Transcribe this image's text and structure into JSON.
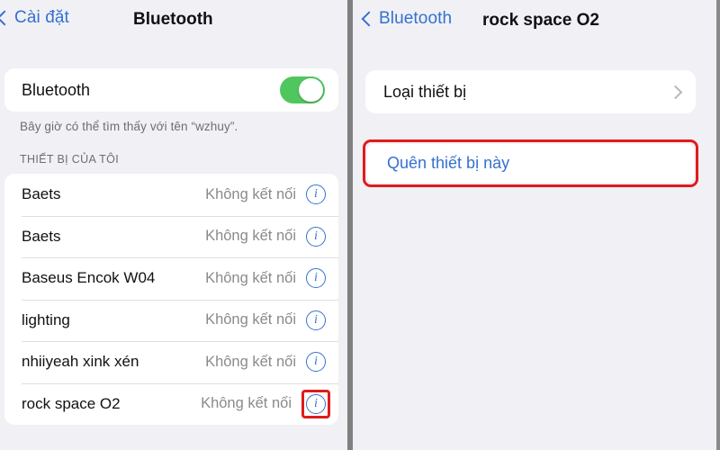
{
  "left_panel": {
    "navbar": {
      "back_label": "Cài đặt",
      "back_icon": "chevron-left-icon",
      "title": "Bluetooth"
    },
    "bluetooth_row": {
      "label": "Bluetooth",
      "toggle_state": "on",
      "toggle_color": "#4FC75E"
    },
    "footnote": "Bây giờ có thể tìm thấy với tên “wzhuy”.",
    "section_header": "THIẾT BỊ CỦA TÔI",
    "devices": [
      {
        "name": "Baets",
        "status": "Không kết nối",
        "info_icon": "info-circle-icon",
        "highlighted": false
      },
      {
        "name": "Baets",
        "status": "Không kết nối",
        "info_icon": "info-circle-icon",
        "highlighted": false
      },
      {
        "name": "Baseus Encok W04",
        "status": "Không kết nối",
        "info_icon": "info-circle-icon",
        "highlighted": false
      },
      {
        "name": "lighting",
        "status": "Không kết nối",
        "info_icon": "info-circle-icon",
        "highlighted": false
      },
      {
        "name": "nhiiyeah xink xén",
        "status": "Không kết nối",
        "info_icon": "info-circle-icon",
        "highlighted": false
      },
      {
        "name": "rock space O2",
        "status": "Không kết nối",
        "info_icon": "info-circle-icon",
        "highlighted": true
      }
    ]
  },
  "right_panel": {
    "navbar": {
      "back_label": "Bluetooth",
      "back_icon": "chevron-left-icon",
      "title": "rock space O2"
    },
    "device_type_row": {
      "label": "Loại thiết bị",
      "chevron_icon": "chevron-right-icon"
    },
    "forget_row": {
      "label": "Quên thiết bị này",
      "highlighted": true
    }
  },
  "annotation": {
    "color": "#E01B1B"
  },
  "colors": {
    "accent_blue": "#3571CF",
    "background": "#F0F0F5",
    "card": "#FFFFFF",
    "secondary_text": "#8A8A8E",
    "divider": "#DFDFE2"
  },
  "info_icon_glyph": "i"
}
